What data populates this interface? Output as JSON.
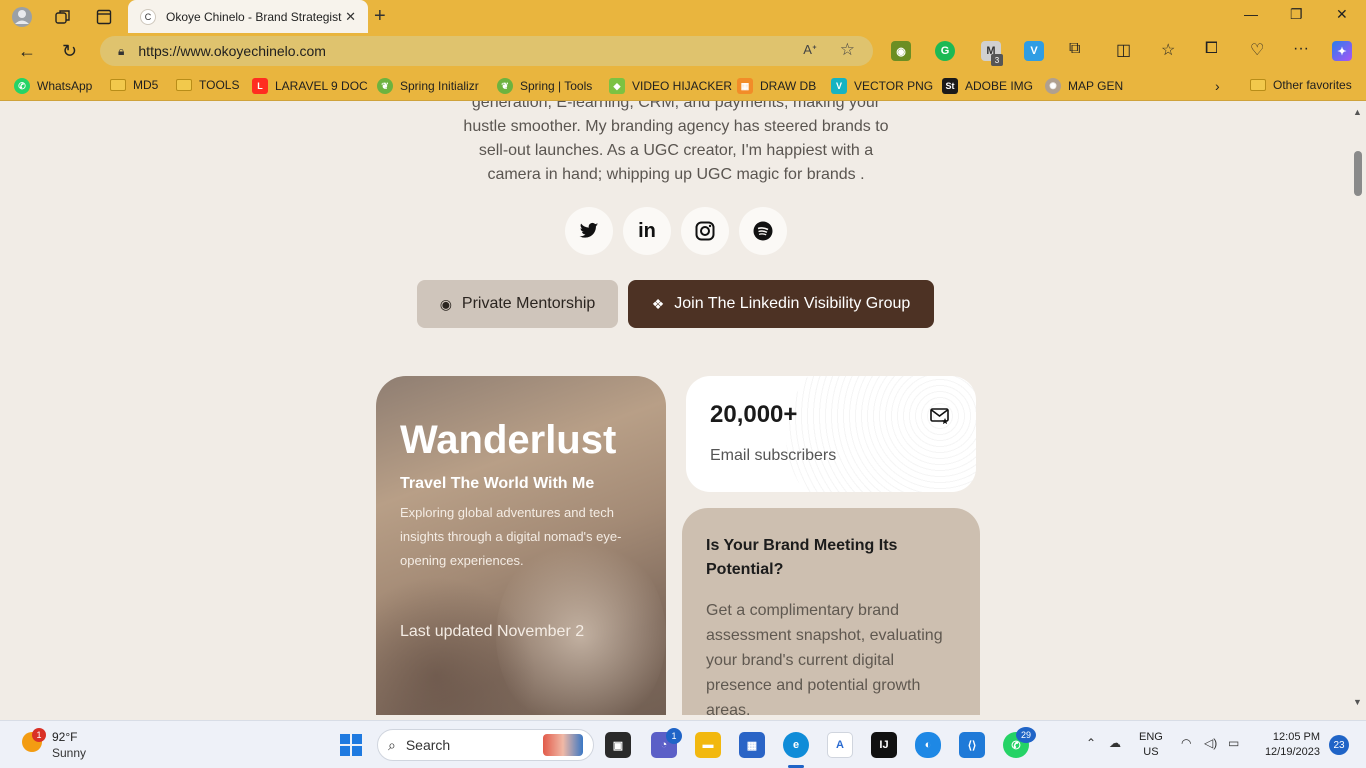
{
  "browser": {
    "tab_title": "Okoye Chinelo - Brand Strategist",
    "tab_favicon": "C",
    "url": "https://www.okoyechinelo.com",
    "ext_badge": "3"
  },
  "bookmarks": [
    {
      "label": "WhatsApp",
      "icon": "whatsapp-icon",
      "color": "#25d366"
    },
    {
      "label": "MD5",
      "icon": "folder-icon",
      "color": "#f2c94c"
    },
    {
      "label": "TOOLS",
      "icon": "folder-icon",
      "color": "#f2c94c"
    },
    {
      "label": "LARAVEL 9 DOC",
      "icon": "laravel-icon",
      "color": "#ff2d20"
    },
    {
      "label": "Spring Initializr",
      "icon": "spring-icon",
      "color": "#6db33f"
    },
    {
      "label": "Spring | Tools",
      "icon": "spring-icon",
      "color": "#6db33f"
    },
    {
      "label": "VIDEO HIJACKER",
      "icon": "gem-icon",
      "color": "#7cc242"
    },
    {
      "label": "DRAW DB",
      "icon": "drawdb-icon",
      "color": "#f28c28"
    },
    {
      "label": "VECTOR PNG",
      "icon": "vector-icon",
      "color": "#16b3c2"
    },
    {
      "label": "ADOBE IMG",
      "icon": "adobe-stock-icon",
      "color": "#1a1a1a"
    },
    {
      "label": "MAP GEN",
      "icon": "map-icon",
      "color": "#b0a090"
    }
  ],
  "other_favorites": "Other favorites",
  "page": {
    "bio_lines": [
      "generation, E-learning, CRM, and payments, making your",
      "hustle smoother. My branding agency has steered brands to",
      "sell-out launches. As a UGC creator, I'm happiest with a",
      "camera in hand; whipping up UGC magic for brands ."
    ],
    "buttons": {
      "mentorship": "Private Mentorship",
      "linkedin": "Join The Linkedin Visibility Group"
    },
    "wanderlust": {
      "title": "Wanderlust",
      "subtitle": "Travel The World With Me",
      "description": "Exploring global adventures and tech insights through a digital nomad's eye-opening experiences.",
      "updated": "Last updated November 2"
    },
    "stats": {
      "number": "20,000+",
      "label": "Email subscribers"
    },
    "brand": {
      "title": "Is Your Brand Meeting Its Potential?",
      "text": "Get a complimentary brand assessment snapshot, evaluating your brand's current digital presence and potential growth areas."
    }
  },
  "taskbar": {
    "weather_temp": "92°F",
    "weather_cond": "Sunny",
    "weather_badge": "1",
    "search_placeholder": "Search",
    "chat_badge": "1",
    "whatsapp_badge": "29",
    "lang_top": "ENG",
    "lang_bottom": "US",
    "time": "12:05 PM",
    "date": "12/19/2023",
    "notifications": "23"
  }
}
